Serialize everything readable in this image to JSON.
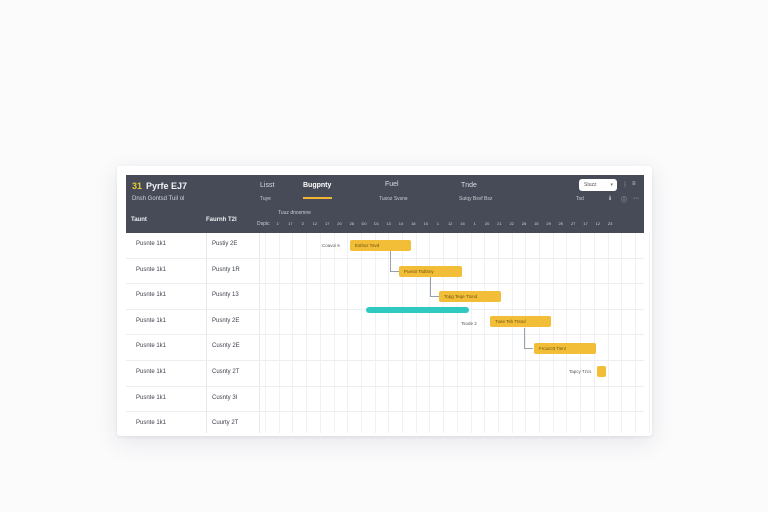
{
  "header": {
    "logo_glyph": "31",
    "project_title": "Pyrfe EJ7",
    "project_subtitle": "Dnsh Gontsd Tuil ol",
    "tabs": [
      {
        "label": "Lisst",
        "active": false
      },
      {
        "label": "Bugpnty",
        "active": true
      },
      {
        "label": "Fuel",
        "active": false
      },
      {
        "label": "Tnde",
        "active": false
      }
    ],
    "sub_labels": [
      "Tuye",
      "Tusoz Svsne",
      "Suiqy Bsvf Bsz",
      "Tsd"
    ],
    "search_value": "Stuzz",
    "icons": [
      "⋮",
      "≡",
      "ℹ",
      "ⓘ",
      "⋯"
    ],
    "col_task": "Taunt",
    "col_assignee": "Faurnh T2l",
    "range_label": "Tuuz dnosmne",
    "day_prefix": "Dspic",
    "ticks": [
      "1'",
      "17",
      "'2",
      "12",
      "17",
      "20",
      "28",
      "D0",
      "D1",
      "13",
      "14",
      "18",
      "15",
      "1",
      "12",
      "16",
      "1",
      "20",
      "21",
      "22",
      "28",
      "15",
      "29",
      "2E",
      "27",
      "17",
      "12",
      "23"
    ]
  },
  "rows": [
    {
      "task": "Pusnte 1k1",
      "assignee": "Pustiy 2E"
    },
    {
      "task": "Pusnte 1k1",
      "assignee": "Pusnty 1R"
    },
    {
      "task": "Pusnte 1k1",
      "assignee": "Pusnty 13"
    },
    {
      "task": "Pusnte 1k1",
      "assignee": "Pusnty 2E"
    },
    {
      "task": "Pusnte 1k1",
      "assignee": "Cusnty 2E"
    },
    {
      "task": "Pusnte 1k1",
      "assignee": "Cusnty 2T"
    },
    {
      "task": "Pusnte 1k1",
      "assignee": "Cusnty 3I"
    },
    {
      "task": "Pusnte 1k1",
      "assignee": "Cuurty 2T"
    }
  ],
  "bars": [
    {
      "label": "Esthxz Tovd",
      "side_label": "Coavoi 6"
    },
    {
      "label": "Pueotr Tsdtsny",
      "side_label": ""
    },
    {
      "label": "Topg Teqe Ttxnd",
      "side_label": ""
    },
    {
      "label": "",
      "side_label": ""
    },
    {
      "label": "Txee Tsh Ttsnd",
      "side_label": "Tsode 2"
    },
    {
      "label": "Frcazctt Tinnr",
      "side_label": ""
    },
    {
      "label": "",
      "side_label": "Tapcy Tzcs"
    }
  ],
  "colors": {
    "header_bg": "#464b57",
    "bar_yellow": "#f2bd37",
    "bar_teal": "#2ec9c1",
    "tab_underline": "#f2b533"
  }
}
